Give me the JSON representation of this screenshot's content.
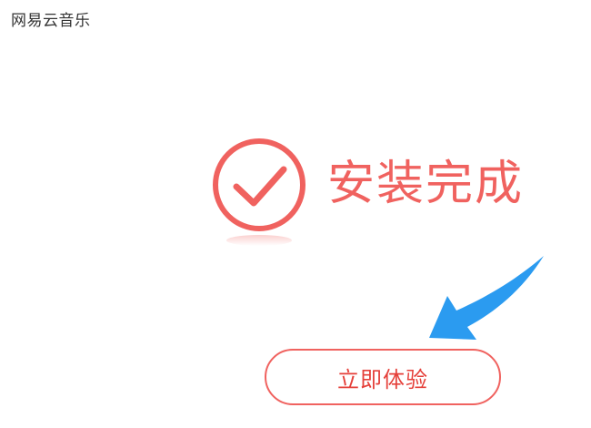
{
  "window": {
    "title": "网易云音乐"
  },
  "main": {
    "status_text": "安装完成",
    "status_icon": "check-circle-icon",
    "hint_icon": "arrow-pointer-icon",
    "start_button_label": "立即体验"
  },
  "colors": {
    "accent": "#f0625f",
    "button_text": "#e5403a",
    "arrow": "#2b9bf0",
    "title_text": "#333333",
    "background": "#ffffff"
  }
}
